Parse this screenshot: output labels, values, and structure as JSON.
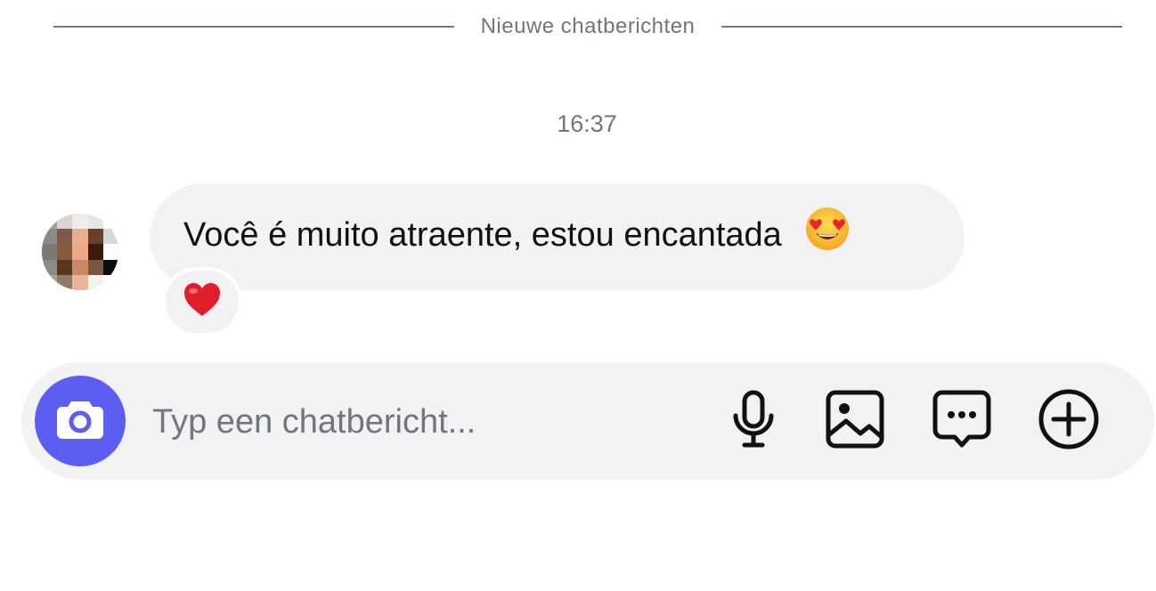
{
  "divider": {
    "label": "Nieuwe chatberichten"
  },
  "timestamp": "16:37",
  "message": {
    "text": "Você é muito atraente, estou encantada",
    "emoji": "smiling-face-with-heart-eyes",
    "reaction": "red-heart"
  },
  "composer": {
    "placeholder": "Typ een chatbericht...",
    "actions": [
      "camera-icon",
      "microphone-icon",
      "image-icon",
      "chat-bubble-icon",
      "plus-circle-icon"
    ]
  },
  "colors": {
    "accent": "#5b5ef0",
    "bubble": "#f2f2f4",
    "muted_text": "#6f7680"
  }
}
